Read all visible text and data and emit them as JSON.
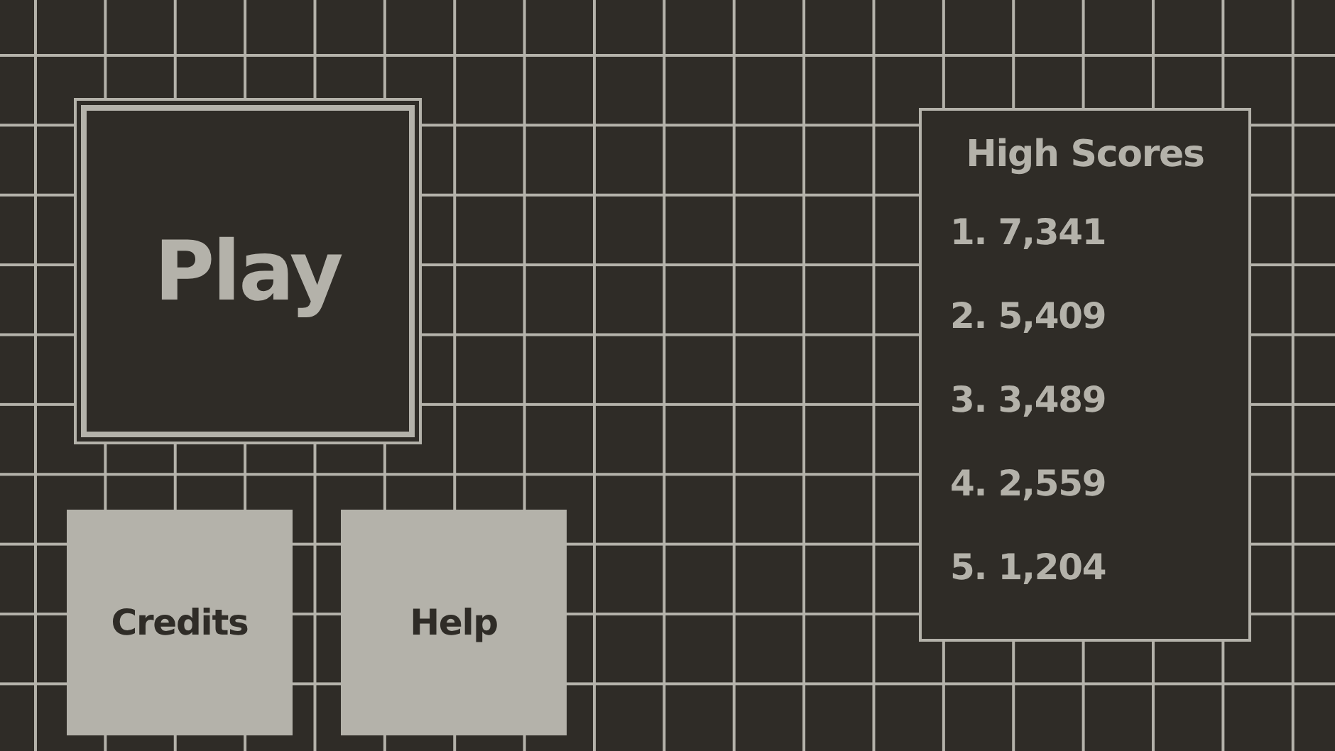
{
  "menu": {
    "play": "Play",
    "buttons": [
      "Credits",
      "Help"
    ]
  },
  "high_scores": {
    "title": "High Scores",
    "entries": [
      "1. 7,341",
      "2. 5,409",
      "3. 3,489",
      "4. 2,559",
      "5. 1,204"
    ]
  }
}
